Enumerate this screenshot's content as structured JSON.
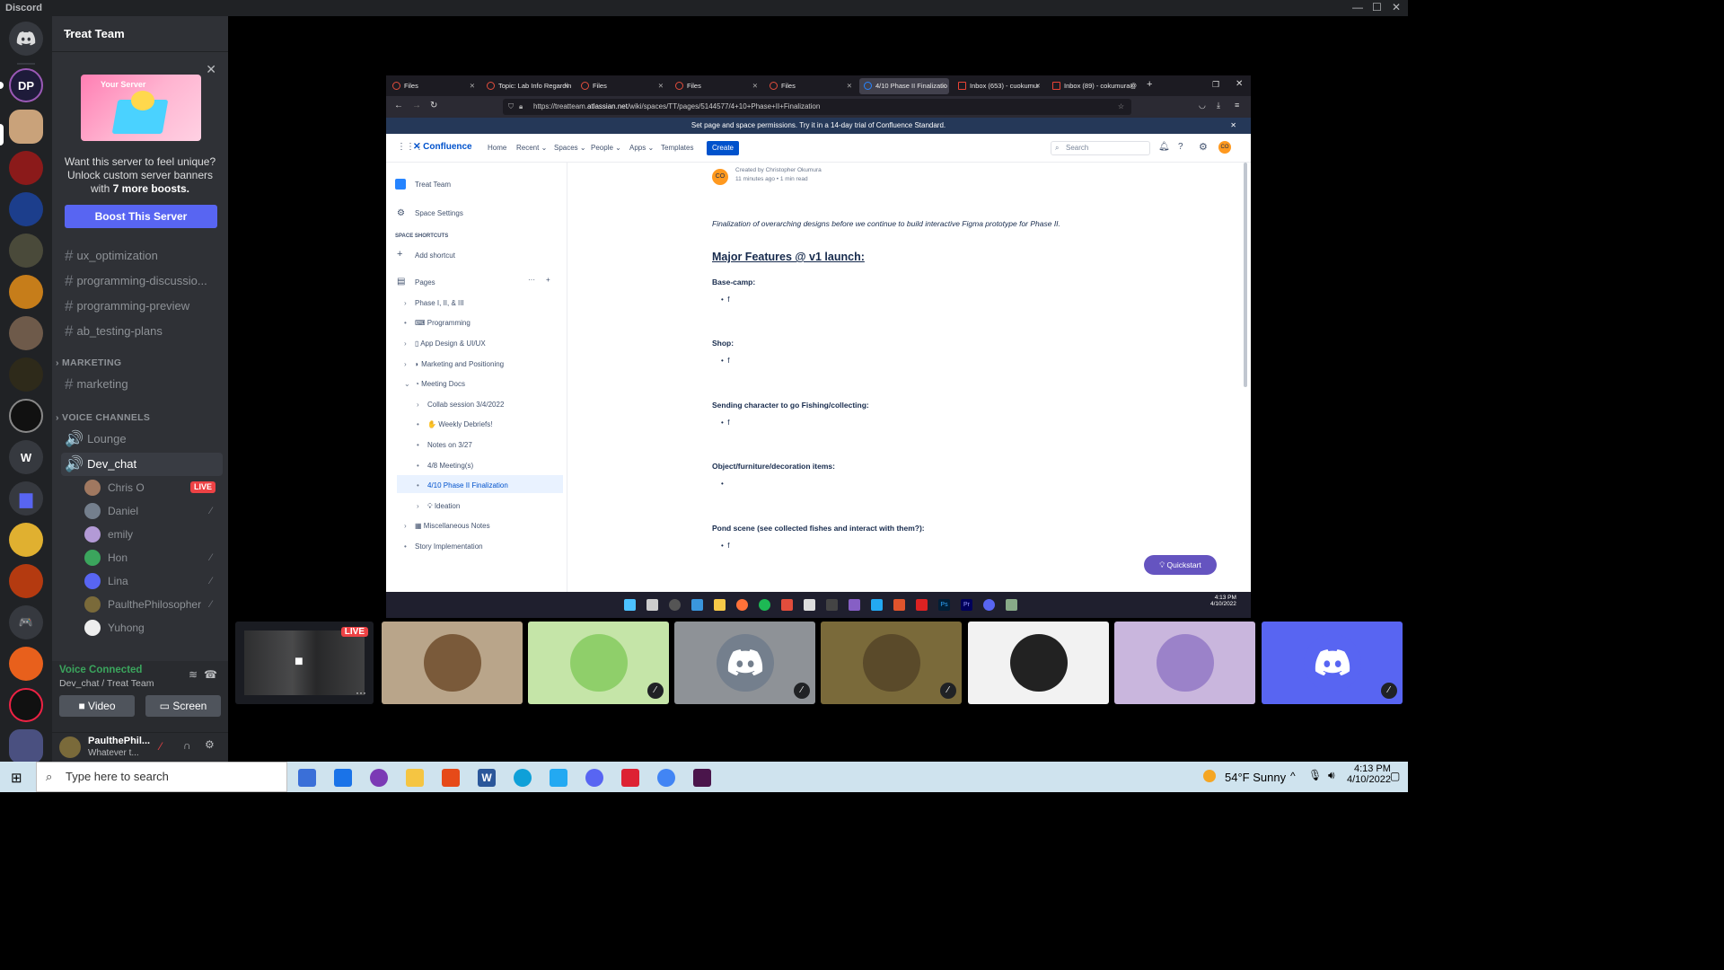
{
  "titlebar": {
    "app_name": "Discord"
  },
  "server": {
    "name": "Treat Team"
  },
  "servers": [
    {
      "name": "Direct Messages",
      "initials": ""
    },
    {
      "name": "DP",
      "initials": "DP"
    },
    {
      "name": "W",
      "initials": "W"
    }
  ],
  "boost": {
    "banner_label": "Your Server",
    "text_main": "Want this server to feel unique? Unlock custom server banners with",
    "text_bold": "7 more boosts.",
    "button": "Boost This Server"
  },
  "channels": {
    "text": [
      "ux_optimization",
      "programming-discussio...",
      "programming-preview",
      "ab_testing-plans"
    ],
    "marketing_category": "MARKETING",
    "marketing": [
      "marketing"
    ],
    "voice_category": "VOICE CHANNELS",
    "voice": [
      "Lounge",
      "Dev_chat"
    ]
  },
  "voice_users": [
    {
      "name": "Chris O",
      "live": "LIVE"
    },
    {
      "name": "Daniel"
    },
    {
      "name": "emily"
    },
    {
      "name": "Hon"
    },
    {
      "name": "Lina"
    },
    {
      "name": "PaulthePhilosopher"
    },
    {
      "name": "Yuhong"
    }
  ],
  "voice_connection": {
    "status": "Voice Connected",
    "location": "Dev_chat / Treat Team",
    "video": "Video",
    "screen": "Screen"
  },
  "user_panel": {
    "name": "PaulthePhil...",
    "status": "Whatever t..."
  },
  "browser": {
    "tabs": [
      "Files",
      "Topic: Lab Info Regardin",
      "Files",
      "Files",
      "Files",
      "4/10 Phase II Finalizatio",
      "Inbox (653) - cuokumur",
      "Inbox (89) - cokumura@"
    ],
    "url_prefix": "https://treatteam.",
    "url_domain": "atlassian.net",
    "url_path": "/wiki/spaces/TT/pages/5144577/4+10+Phase+II+Finalization",
    "notice": "Set page and space permissions. Try it in a 14-day trial of Confluence Standard."
  },
  "confluence": {
    "logo": "Confluence",
    "nav": [
      "Home",
      "Recent",
      "Spaces",
      "People",
      "Apps",
      "Templates"
    ],
    "create": "Create",
    "search_placeholder": "Search",
    "avatar_initials": "CO",
    "space_name": "Treat Team",
    "space_settings": "Space Settings",
    "shortcuts_label": "SPACE SHORTCUTS",
    "add_shortcut": "Add shortcut",
    "pages_label": "Pages",
    "pages": [
      "Phase I, II, & III",
      "Programming",
      "App Design & UI/UX",
      "Marketing and Positioning",
      "Meeting Docs",
      "Collab session 3/4/2022",
      "Weekly Debriefs!",
      "Notes on 3/27",
      "4/8 Meeting(s)",
      "4/10 Phase II Finalization",
      "Ideation",
      "Miscellaneous Notes",
      "Story Implementation"
    ],
    "byline": "Created by Christopher Okumura",
    "byline_meta": "11 minutes ago  •  1 min read",
    "intro": "Finalization of overarching designs before we continue to build interactive Figma prototype for Phase II.",
    "heading": "Major Features @ v1 launch:",
    "sections": [
      {
        "title": "Base-camp:",
        "bullet": "f"
      },
      {
        "title": "Shop:",
        "bullet": "f"
      },
      {
        "title": "Sending character to go Fishing/collecting:",
        "bullet": "f"
      },
      {
        "title": "Object/furniture/decoration items:",
        "bullet": ""
      },
      {
        "title": "Pond scene (see collected fishes and interact with them?):",
        "bullet": "f"
      }
    ],
    "quickstart": "Quickstart"
  },
  "inner_clock": {
    "time": "4:13 PM",
    "date": "4/10/2022"
  },
  "stream_tile": {
    "live": "LIVE"
  },
  "taskbar": {
    "search_placeholder": "Type here to search",
    "weather": "54°F  Sunny",
    "time": "4:13 PM",
    "date": "4/10/2022"
  },
  "colors": {
    "blurple": "#5865f2",
    "green": "#3ba55d",
    "red": "#ed4245",
    "confluence_blue": "#0052cc"
  }
}
